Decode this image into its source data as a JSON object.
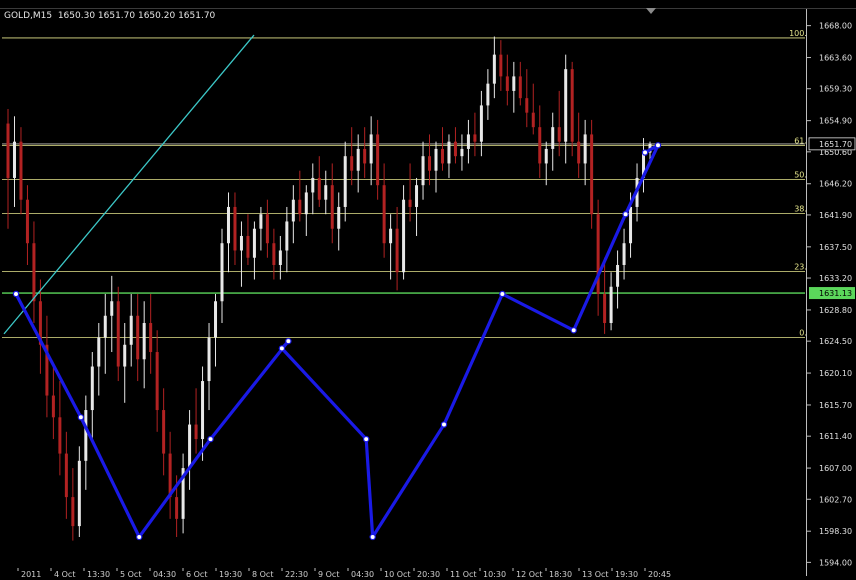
{
  "header": {
    "symbol": "GOLD,M15",
    "quote": "1650.30 1651.70 1650.20 1651.70"
  },
  "colors": {
    "background": "#000000",
    "bull_candle": "#e8e8e8",
    "bear_candle": "#b22222",
    "fib_line": "#e5e58c",
    "trend_line": "#3cc8c8",
    "support_line": "#5bd75b",
    "pattern_line": "#1a1ae6",
    "current_price_line": "#bdbdbd"
  },
  "chart_data": {
    "type": "candlestick",
    "ylim": [
      1593.5,
      1668.5
    ],
    "yticks": [
      "1668.00",
      "1663.60",
      "1659.30",
      "1654.90",
      "1650.60",
      "1646.20",
      "1641.90",
      "1637.50",
      "1633.20",
      "1628.80",
      "1624.50",
      "1620.10",
      "1615.70",
      "1611.40",
      "1607.00",
      "1602.70",
      "1598.30",
      "1594.00"
    ],
    "current_price": {
      "label": "1651.70",
      "value": 1651.7
    },
    "support_price": {
      "label": "1631.13",
      "value": 1631.13
    },
    "fib_levels": [
      {
        "label": "100.0",
        "value": 1666.3
      },
      {
        "label": "61.8",
        "value": 1651.5
      },
      {
        "label": "50.0",
        "value": 1646.8
      },
      {
        "label": "38.2",
        "value": 1642.1
      },
      {
        "label": "23.6",
        "value": 1634.1
      },
      {
        "label": "0.0",
        "value": 1625.0
      }
    ],
    "time_labels": [
      "2011",
      "4 Oct",
      "13:30",
      "5 Oct",
      "04:30",
      "6 Oct",
      "19:30",
      "8 Oct",
      "22:30",
      "9 Oct",
      "04:30",
      "10 Oct",
      "20:30",
      "11 Oct",
      "10:30",
      "12 Oct",
      "18:30",
      "13 Oct",
      "19:30",
      "20:45"
    ],
    "trend_line": {
      "x": [
        0,
        246
      ],
      "y": [
        1625.5,
        1666.7
      ]
    },
    "pattern_line": {
      "x": [
        0,
        16,
        30,
        46,
        65,
        64,
        84,
        85,
        102,
        116,
        133,
        145,
        153,
        150
      ],
      "y": [
        1631.0,
        1614.0,
        1597.5,
        1611.0,
        1624.5,
        1623.5,
        1611.0,
        1597.5,
        1613.0,
        1631.0,
        1626.0,
        1642.0,
        1651.5,
        1650.5
      ]
    },
    "candles": [
      {
        "x": 0,
        "o": 1654.5,
        "h": 1656.5,
        "l": 1640.0,
        "c": 1647.0
      },
      {
        "x": 1,
        "o": 1647.0,
        "h": 1655.5,
        "l": 1643.0,
        "c": 1652.0
      },
      {
        "x": 2,
        "o": 1652.0,
        "h": 1654.0,
        "l": 1642.0,
        "c": 1644.0
      },
      {
        "x": 3,
        "o": 1644.0,
        "h": 1646.0,
        "l": 1635.0,
        "c": 1638.0
      },
      {
        "x": 4,
        "o": 1638.0,
        "h": 1641.0,
        "l": 1627.0,
        "c": 1630.0
      },
      {
        "x": 5,
        "o": 1630.0,
        "h": 1633.0,
        "l": 1620.0,
        "c": 1624.0
      },
      {
        "x": 6,
        "o": 1624.0,
        "h": 1628.0,
        "l": 1614.0,
        "c": 1617.0
      },
      {
        "x": 7,
        "o": 1617.0,
        "h": 1621.0,
        "l": 1611.0,
        "c": 1614.0
      },
      {
        "x": 8,
        "o": 1614.0,
        "h": 1619.0,
        "l": 1606.0,
        "c": 1609.0
      },
      {
        "x": 9,
        "o": 1609.0,
        "h": 1612.0,
        "l": 1600.0,
        "c": 1603.0
      },
      {
        "x": 10,
        "o": 1603.0,
        "h": 1607.0,
        "l": 1597.0,
        "c": 1599.0
      },
      {
        "x": 11,
        "o": 1599.0,
        "h": 1610.0,
        "l": 1597.5,
        "c": 1608.0
      },
      {
        "x": 12,
        "o": 1608.0,
        "h": 1617.0,
        "l": 1604.0,
        "c": 1615.0
      },
      {
        "x": 13,
        "o": 1615.0,
        "h": 1623.0,
        "l": 1611.0,
        "c": 1621.0
      },
      {
        "x": 14,
        "o": 1621.0,
        "h": 1627.0,
        "l": 1617.0,
        "c": 1625.0
      },
      {
        "x": 15,
        "o": 1625.0,
        "h": 1631.0,
        "l": 1620.0,
        "c": 1628.0
      },
      {
        "x": 16,
        "o": 1628.0,
        "h": 1633.5,
        "l": 1623.0,
        "c": 1630.0
      },
      {
        "x": 17,
        "o": 1630.0,
        "h": 1632.0,
        "l": 1619.0,
        "c": 1621.0
      },
      {
        "x": 18,
        "o": 1621.0,
        "h": 1627.0,
        "l": 1616.0,
        "c": 1624.0
      },
      {
        "x": 19,
        "o": 1624.0,
        "h": 1631.0,
        "l": 1621.0,
        "c": 1628.0
      },
      {
        "x": 20,
        "o": 1628.0,
        "h": 1631.0,
        "l": 1619.0,
        "c": 1622.0
      },
      {
        "x": 21,
        "o": 1622.0,
        "h": 1630.0,
        "l": 1618.0,
        "c": 1627.0
      },
      {
        "x": 22,
        "o": 1627.0,
        "h": 1631.0,
        "l": 1620.0,
        "c": 1623.0
      },
      {
        "x": 23,
        "o": 1623.0,
        "h": 1626.0,
        "l": 1612.0,
        "c": 1615.0
      },
      {
        "x": 24,
        "o": 1615.0,
        "h": 1618.0,
        "l": 1606.0,
        "c": 1609.0
      },
      {
        "x": 25,
        "o": 1609.0,
        "h": 1612.0,
        "l": 1600.0,
        "c": 1603.0
      },
      {
        "x": 26,
        "o": 1603.0,
        "h": 1606.0,
        "l": 1597.5,
        "c": 1600.0
      },
      {
        "x": 27,
        "o": 1600.0,
        "h": 1609.0,
        "l": 1598.0,
        "c": 1607.0
      },
      {
        "x": 28,
        "o": 1607.0,
        "h": 1615.0,
        "l": 1604.0,
        "c": 1613.0
      },
      {
        "x": 29,
        "o": 1613.0,
        "h": 1618.0,
        "l": 1609.0,
        "c": 1611.0
      },
      {
        "x": 30,
        "o": 1611.0,
        "h": 1621.0,
        "l": 1608.0,
        "c": 1619.0
      },
      {
        "x": 31,
        "o": 1619.0,
        "h": 1627.0,
        "l": 1615.0,
        "c": 1625.0
      },
      {
        "x": 32,
        "o": 1625.0,
        "h": 1631.0,
        "l": 1621.0,
        "c": 1630.0
      },
      {
        "x": 33,
        "o": 1630.0,
        "h": 1640.0,
        "l": 1627.0,
        "c": 1638.0
      },
      {
        "x": 34,
        "o": 1638.0,
        "h": 1645.0,
        "l": 1634.0,
        "c": 1643.0
      },
      {
        "x": 35,
        "o": 1643.0,
        "h": 1645.0,
        "l": 1635.0,
        "c": 1637.0
      },
      {
        "x": 36,
        "o": 1637.0,
        "h": 1641.0,
        "l": 1632.0,
        "c": 1639.0
      },
      {
        "x": 37,
        "o": 1639.0,
        "h": 1642.0,
        "l": 1635.0,
        "c": 1636.0
      },
      {
        "x": 38,
        "o": 1636.0,
        "h": 1641.0,
        "l": 1633.0,
        "c": 1640.0
      },
      {
        "x": 39,
        "o": 1640.0,
        "h": 1643.0,
        "l": 1637.0,
        "c": 1642.0
      },
      {
        "x": 40,
        "o": 1642.0,
        "h": 1644.0,
        "l": 1636.0,
        "c": 1638.0
      },
      {
        "x": 41,
        "o": 1638.0,
        "h": 1640.0,
        "l": 1633.0,
        "c": 1635.0
      },
      {
        "x": 42,
        "o": 1635.0,
        "h": 1639.0,
        "l": 1633.0,
        "c": 1637.0
      },
      {
        "x": 43,
        "o": 1637.0,
        "h": 1643.0,
        "l": 1634.0,
        "c": 1641.0
      },
      {
        "x": 44,
        "o": 1641.0,
        "h": 1646.0,
        "l": 1638.0,
        "c": 1644.0
      },
      {
        "x": 45,
        "o": 1644.0,
        "h": 1648.0,
        "l": 1641.0,
        "c": 1642.0
      },
      {
        "x": 46,
        "o": 1642.0,
        "h": 1646.0,
        "l": 1639.0,
        "c": 1645.0
      },
      {
        "x": 47,
        "o": 1645.0,
        "h": 1649.0,
        "l": 1642.0,
        "c": 1647.0
      },
      {
        "x": 48,
        "o": 1647.0,
        "h": 1650.0,
        "l": 1643.0,
        "c": 1644.0
      },
      {
        "x": 49,
        "o": 1644.0,
        "h": 1648.0,
        "l": 1642.0,
        "c": 1646.0
      },
      {
        "x": 50,
        "o": 1646.0,
        "h": 1649.0,
        "l": 1638.0,
        "c": 1640.0
      },
      {
        "x": 51,
        "o": 1640.0,
        "h": 1645.0,
        "l": 1637.0,
        "c": 1643.0
      },
      {
        "x": 52,
        "o": 1643.0,
        "h": 1652.0,
        "l": 1641.0,
        "c": 1650.0
      },
      {
        "x": 53,
        "o": 1650.0,
        "h": 1654.0,
        "l": 1646.0,
        "c": 1648.0
      },
      {
        "x": 54,
        "o": 1648.0,
        "h": 1653.0,
        "l": 1645.0,
        "c": 1651.0
      },
      {
        "x": 55,
        "o": 1651.0,
        "h": 1654.0,
        "l": 1647.0,
        "c": 1649.0
      },
      {
        "x": 56,
        "o": 1649.0,
        "h": 1655.5,
        "l": 1646.0,
        "c": 1653.0
      },
      {
        "x": 57,
        "o": 1653.0,
        "h": 1655.0,
        "l": 1644.0,
        "c": 1646.0
      },
      {
        "x": 58,
        "o": 1646.0,
        "h": 1649.0,
        "l": 1636.0,
        "c": 1638.0
      },
      {
        "x": 59,
        "o": 1638.0,
        "h": 1642.0,
        "l": 1633.0,
        "c": 1640.0
      },
      {
        "x": 60,
        "o": 1640.0,
        "h": 1643.0,
        "l": 1631.5,
        "c": 1634.0
      },
      {
        "x": 61,
        "o": 1634.0,
        "h": 1646.0,
        "l": 1633.0,
        "c": 1644.0
      },
      {
        "x": 62,
        "o": 1644.0,
        "h": 1649.0,
        "l": 1641.0,
        "c": 1643.0
      },
      {
        "x": 63,
        "o": 1643.0,
        "h": 1647.0,
        "l": 1639.0,
        "c": 1646.0
      },
      {
        "x": 64,
        "o": 1646.0,
        "h": 1652.0,
        "l": 1644.0,
        "c": 1650.0
      },
      {
        "x": 65,
        "o": 1650.0,
        "h": 1653.0,
        "l": 1646.0,
        "c": 1648.0
      },
      {
        "x": 66,
        "o": 1648.0,
        "h": 1652.0,
        "l": 1645.0,
        "c": 1651.0
      },
      {
        "x": 67,
        "o": 1651.0,
        "h": 1654.0,
        "l": 1648.0,
        "c": 1649.0
      },
      {
        "x": 68,
        "o": 1649.0,
        "h": 1653.0,
        "l": 1647.0,
        "c": 1652.0
      },
      {
        "x": 69,
        "o": 1652.0,
        "h": 1654.0,
        "l": 1649.0,
        "c": 1650.0
      },
      {
        "x": 70,
        "o": 1650.0,
        "h": 1653.0,
        "l": 1648.0,
        "c": 1651.0
      },
      {
        "x": 71,
        "o": 1651.0,
        "h": 1655.0,
        "l": 1649.0,
        "c": 1653.0
      },
      {
        "x": 72,
        "o": 1653.0,
        "h": 1656.0,
        "l": 1650.0,
        "c": 1652.0
      },
      {
        "x": 73,
        "o": 1652.0,
        "h": 1659.0,
        "l": 1650.0,
        "c": 1657.0
      },
      {
        "x": 74,
        "o": 1657.0,
        "h": 1662.0,
        "l": 1655.0,
        "c": 1660.0
      },
      {
        "x": 75,
        "o": 1660.0,
        "h": 1666.5,
        "l": 1658.0,
        "c": 1664.0
      },
      {
        "x": 76,
        "o": 1664.0,
        "h": 1666.0,
        "l": 1659.0,
        "c": 1661.0
      },
      {
        "x": 77,
        "o": 1661.0,
        "h": 1664.0,
        "l": 1657.0,
        "c": 1659.0
      },
      {
        "x": 78,
        "o": 1659.0,
        "h": 1663.0,
        "l": 1656.0,
        "c": 1661.0
      },
      {
        "x": 79,
        "o": 1661.0,
        "h": 1663.0,
        "l": 1657.0,
        "c": 1658.0
      },
      {
        "x": 80,
        "o": 1658.0,
        "h": 1662.0,
        "l": 1654.0,
        "c": 1656.0
      },
      {
        "x": 81,
        "o": 1656.0,
        "h": 1660.0,
        "l": 1653.0,
        "c": 1654.0
      },
      {
        "x": 82,
        "o": 1654.0,
        "h": 1657.0,
        "l": 1647.0,
        "c": 1649.0
      },
      {
        "x": 83,
        "o": 1649.0,
        "h": 1652.0,
        "l": 1646.0,
        "c": 1651.0
      },
      {
        "x": 84,
        "o": 1651.0,
        "h": 1656.0,
        "l": 1648.0,
        "c": 1654.0
      },
      {
        "x": 85,
        "o": 1654.0,
        "h": 1659.0,
        "l": 1650.0,
        "c": 1652.0
      },
      {
        "x": 86,
        "o": 1652.0,
        "h": 1664.0,
        "l": 1649.0,
        "c": 1662.0
      },
      {
        "x": 87,
        "o": 1662.0,
        "h": 1663.0,
        "l": 1650.0,
        "c": 1652.0
      },
      {
        "x": 88,
        "o": 1652.0,
        "h": 1656.0,
        "l": 1647.0,
        "c": 1649.0
      },
      {
        "x": 89,
        "o": 1649.0,
        "h": 1655.0,
        "l": 1646.0,
        "c": 1653.0
      },
      {
        "x": 90,
        "o": 1653.0,
        "h": 1655.0,
        "l": 1640.0,
        "c": 1642.0
      },
      {
        "x": 91,
        "o": 1642.0,
        "h": 1644.0,
        "l": 1628.0,
        "c": 1631.0
      },
      {
        "x": 92,
        "o": 1631.0,
        "h": 1636.0,
        "l": 1625.5,
        "c": 1627.0
      },
      {
        "x": 93,
        "o": 1627.0,
        "h": 1634.0,
        "l": 1626.0,
        "c": 1632.0
      },
      {
        "x": 94,
        "o": 1632.0,
        "h": 1637.0,
        "l": 1629.0,
        "c": 1635.0
      },
      {
        "x": 95,
        "o": 1635.0,
        "h": 1640.0,
        "l": 1633.0,
        "c": 1638.0
      },
      {
        "x": 96,
        "o": 1638.0,
        "h": 1645.0,
        "l": 1636.0,
        "c": 1643.0
      },
      {
        "x": 97,
        "o": 1643.0,
        "h": 1649.0,
        "l": 1641.0,
        "c": 1647.0
      },
      {
        "x": 98,
        "o": 1647.0,
        "h": 1652.5,
        "l": 1645.0,
        "c": 1650.5
      },
      {
        "x": 99,
        "o": 1650.5,
        "h": 1652.0,
        "l": 1649.5,
        "c": 1651.7
      }
    ]
  }
}
